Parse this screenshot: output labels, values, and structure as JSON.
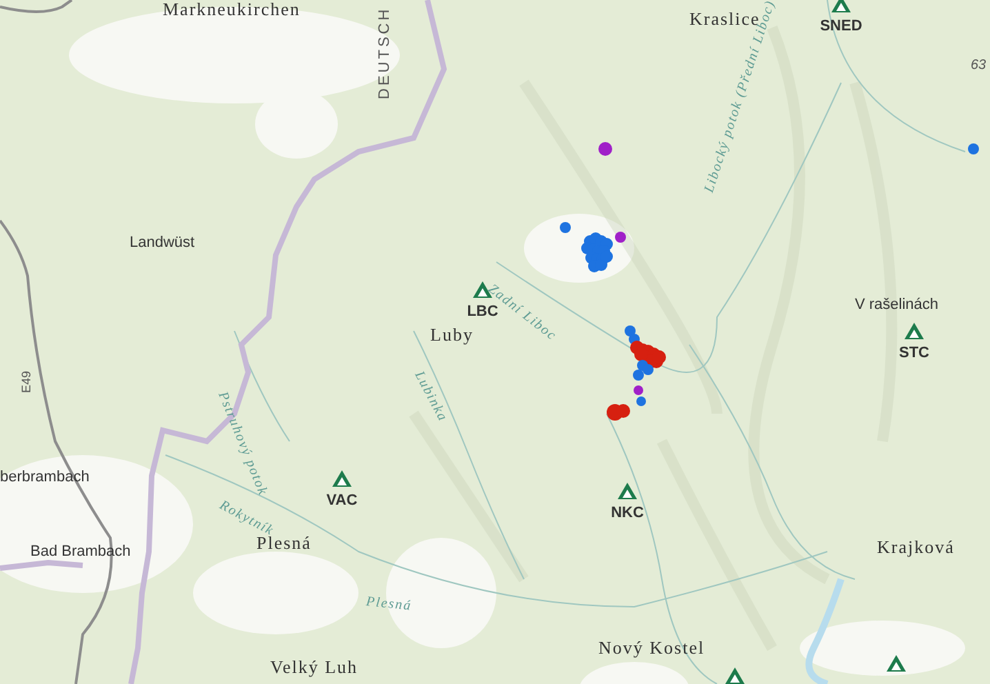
{
  "labels": [
    {
      "kind": "town",
      "text": "Markneukirchen"
    },
    {
      "kind": "country",
      "text": "DEUTSCH"
    },
    {
      "kind": "town",
      "text": "Kraslice"
    },
    {
      "kind": "number",
      "text": "63"
    },
    {
      "kind": "village",
      "text": "Landwüst"
    },
    {
      "kind": "town",
      "text": "Luby"
    },
    {
      "kind": "river",
      "text": "Zadní Liboc"
    },
    {
      "kind": "river",
      "text": "Libocký potok (Přední Liboc)"
    },
    {
      "kind": "village",
      "text": "V rašelinách"
    },
    {
      "kind": "river",
      "text": "Lubinka"
    },
    {
      "kind": "road",
      "text": "E49"
    },
    {
      "kind": "river",
      "text": "Pstruhový potok"
    },
    {
      "kind": "village",
      "text": "berbrambach"
    },
    {
      "kind": "river",
      "text": "Rokytník"
    },
    {
      "kind": "town",
      "text": "Plesná"
    },
    {
      "kind": "village",
      "text": "Bad Brambach"
    },
    {
      "kind": "river",
      "text": "Plesná"
    },
    {
      "kind": "town",
      "text": "Krajková"
    },
    {
      "kind": "town",
      "text": "Nový Kostel"
    },
    {
      "kind": "town",
      "text": "Velký Luh"
    }
  ],
  "stations": [
    {
      "kind": "labeled",
      "code": "SNED"
    },
    {
      "kind": "labeled",
      "code": "LBC"
    },
    {
      "kind": "labeled",
      "code": "STC"
    },
    {
      "kind": "labeled",
      "code": "VAC"
    },
    {
      "kind": "labeled",
      "code": "NKC"
    },
    {
      "kind": "cut"
    },
    {
      "kind": "cut"
    }
  ],
  "events": [
    {
      "color": "#1e73e0"
    },
    {
      "color": "#a020c8"
    },
    {
      "color": "#a020c8"
    },
    {
      "color": "#1e73e0"
    },
    {
      "color": "#1e73e0"
    },
    {
      "color": "#1e73e0"
    },
    {
      "color": "#1e73e0"
    },
    {
      "color": "#1e73e0"
    },
    {
      "color": "#1e73e0"
    },
    {
      "color": "#1e73e0"
    },
    {
      "color": "#1e73e0"
    },
    {
      "color": "#1e73e0"
    },
    {
      "color": "#1e73e0"
    },
    {
      "color": "#1e73e0"
    },
    {
      "color": "#1e73e0"
    },
    {
      "color": "#1e73e0"
    },
    {
      "color": "#1e73e0"
    },
    {
      "color": "#1e73e0"
    },
    {
      "color": "#1e73e0"
    },
    {
      "color": "#d62010"
    },
    {
      "color": "#d62010"
    },
    {
      "color": "#d62010"
    },
    {
      "color": "#d62010"
    },
    {
      "color": "#d62010"
    },
    {
      "color": "#d62010"
    },
    {
      "color": "#d62010"
    },
    {
      "color": "#d62010"
    },
    {
      "color": "#d62010"
    },
    {
      "color": "#1e73e0"
    },
    {
      "color": "#1e73e0"
    },
    {
      "color": "#1e73e0"
    },
    {
      "color": "#a020c8"
    },
    {
      "color": "#1e73e0"
    },
    {
      "color": "#d62010"
    },
    {
      "color": "#d62010"
    },
    {
      "color": "#1e73e0"
    }
  ]
}
